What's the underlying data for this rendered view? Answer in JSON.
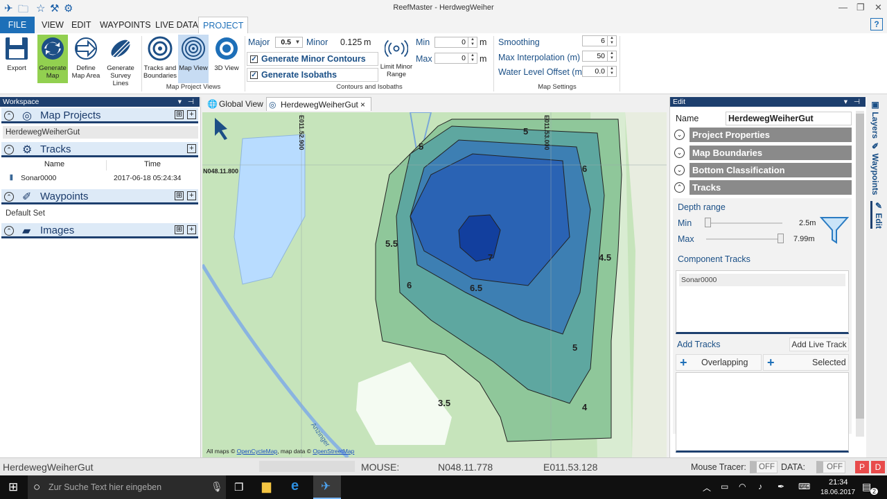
{
  "window": {
    "title": "ReefMaster - HerdwegWeiher"
  },
  "menu": {
    "items": [
      "FILE",
      "VIEW",
      "EDIT",
      "WAYPOINTS",
      "LIVE DATA",
      "PROJECT"
    ],
    "help": "?"
  },
  "ribbon": {
    "buttons": {
      "export": "Export",
      "generate_map": "Generate Map",
      "define_map_area": "Define Map Area",
      "generate_survey_lines": "Generate Survey Lines",
      "tracks_boundaries": "Tracks and Boundaries",
      "map_view": "Map View",
      "view_3d": "3D View",
      "limit_minor_range": "Limit Minor Range"
    },
    "groups": {
      "map_project_views": "Map Project Views",
      "contours_isobaths": "Contours and Isobaths",
      "map_settings": "Map Settings"
    },
    "contours": {
      "major_label": "Major",
      "major_value": "0.5",
      "minor_label": "Minor",
      "minor_value": "0.125",
      "minor_unit": "m",
      "generate_minor_contours": "Generate Minor Contours",
      "generate_isobaths": "Generate Isobaths",
      "min_label": "Min",
      "min_value": "0",
      "max_label": "Max",
      "max_value": "0",
      "unit": "m"
    },
    "settings": {
      "smoothing_label": "Smoothing",
      "smoothing_value": "6",
      "interp_label": "Max Interpolation (m)",
      "interp_value": "50",
      "water_label": "Water Level Offset (m)",
      "water_value": "0.0"
    }
  },
  "workspace": {
    "header": "Workspace",
    "map_projects": {
      "title": "Map Projects",
      "items": [
        "HerdewegWeiherGut"
      ]
    },
    "tracks": {
      "title": "Tracks",
      "col_name": "Name",
      "col_time": "Time",
      "rows": [
        {
          "name": "Sonar0000",
          "time": "2017-06-18 05:24:34"
        }
      ]
    },
    "waypoints": {
      "title": "Waypoints",
      "items": [
        "Default Set"
      ]
    },
    "images": {
      "title": "Images"
    }
  },
  "tabs": {
    "global": "Global View",
    "active": "HerdewegWeiherGut",
    "close": "×"
  },
  "map": {
    "coord_e1": "E011.52.900",
    "coord_e2": "E011.53.000",
    "coord_n": "N048.11.800",
    "attribution_prefix": "All maps ©",
    "attribution_link1": "OpenCycleMap",
    "attribution_mid": ", map data ©",
    "attribution_link2": "OpenStreetMap",
    "depth_labels": [
      "5",
      "5",
      "6",
      "5.5",
      "6",
      "6.5",
      "7",
      "4.5",
      "5",
      "3.5",
      "4"
    ],
    "road_label": "Anzinger"
  },
  "edit": {
    "header": "Edit",
    "name_label": "Name",
    "name_value": "HerdewegWeiherGut",
    "sections": [
      "Project Properties",
      "Map Boundaries",
      "Bottom Classification",
      "Tracks"
    ],
    "depth_range": "Depth range",
    "min_label": "Min",
    "min_value": "2.5m",
    "max_label": "Max",
    "max_value": "7.99m",
    "component_tracks": "Component Tracks",
    "component_items": [
      "Sonar0000"
    ],
    "add_tracks": "Add Tracks",
    "add_live_track": "Add Live Track",
    "overlapping": "Overlapping",
    "selected": "Selected"
  },
  "sidetabs": [
    "Layers",
    "Waypoints",
    "Edit"
  ],
  "status": {
    "project": "HerdewegWeiherGut",
    "mouse_label": "MOUSE:",
    "lat": "N048.11.778",
    "lon": "E011.53.128",
    "tracer_label": "Mouse Tracer:",
    "tracer_value": "OFF",
    "data_label": "DATA:",
    "data_value": "OFF",
    "btn_p": "P",
    "btn_d": "D"
  },
  "taskbar": {
    "search_placeholder": "Zur Suche Text hier eingeben",
    "time": "21:34",
    "date": "18.06.2017",
    "notif": "2"
  }
}
